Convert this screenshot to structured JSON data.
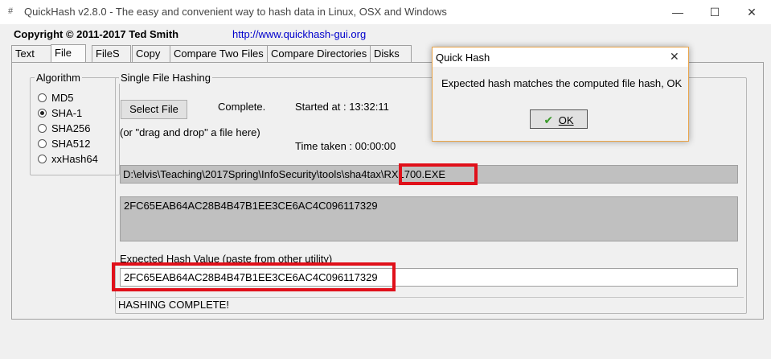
{
  "window": {
    "title": "QuickHash v2.8.0 - The easy and convenient way to hash data in Linux, OSX and Windows",
    "minimize": "—",
    "maximize": "☐",
    "close": "✕"
  },
  "header": {
    "copyright": "Copyright © 2011-2017  Ted Smith",
    "website": "http://www.quickhash-gui.org"
  },
  "tabs": [
    {
      "label": "Text"
    },
    {
      "label": "File"
    },
    {
      "label": "FileS"
    },
    {
      "label": "Copy"
    },
    {
      "label": "Compare Two Files"
    },
    {
      "label": "Compare Directories"
    },
    {
      "label": "Disks"
    }
  ],
  "active_tab": "File",
  "algorithm": {
    "label": "Algorithm",
    "options": [
      "MD5",
      "SHA-1",
      "SHA256",
      "SHA512",
      "xxHash64"
    ],
    "selected": "SHA-1"
  },
  "single_file": {
    "label": "Single File Hashing",
    "select_button": "Select File",
    "status": "Complete.",
    "started_at": "Started at  : 13:32:11",
    "drag_hint": "(or \"drag and drop\" a file here)",
    "time_taken": "Time taken : 00:00:00",
    "file_path": "D:\\elvis\\Teaching\\2017Spring\\InfoSecurity\\tools\\sha4tax\\RX1700.EXE",
    "computed_hash": "2FC65EAB64AC28B4B47B1EE3CE6AC4C096117329",
    "expected_label": "Expected Hash Value (paste from other utility)",
    "expected_value": "2FC65EAB64AC28B4B47B1EE3CE6AC4C096117329",
    "status_bar": "HASHING COMPLETE!"
  },
  "dialog": {
    "title": "Quick Hash",
    "message": "Expected hash matches the computed file hash, OK",
    "ok_button": "OK",
    "close": "✕"
  },
  "colors": {
    "highlight_red": "#e0101a",
    "link_blue": "#0000cc",
    "check_green": "#3a9a2a"
  }
}
